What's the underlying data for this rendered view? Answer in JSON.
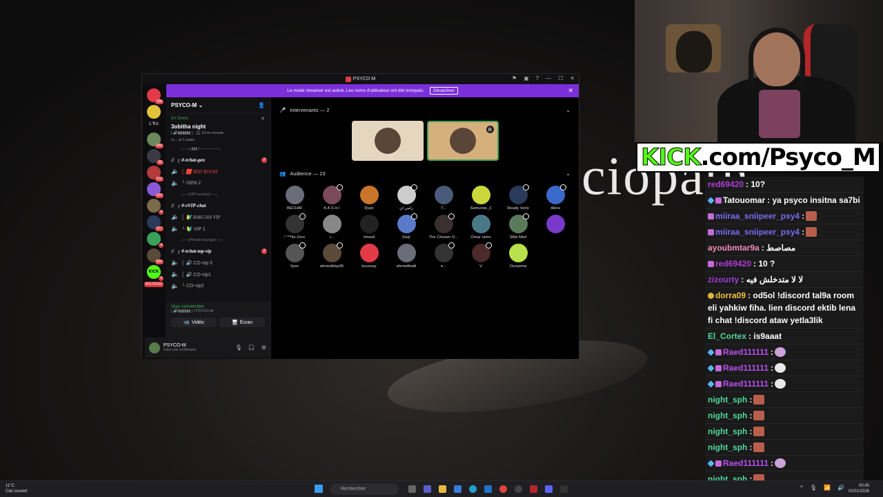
{
  "background": {
    "overlay_text": "ciopath"
  },
  "banner_kick": {
    "brand": "KICK",
    "rest": ".com/Psyco_M"
  },
  "chat": [
    {
      "user": "red69420",
      "color": "#b03bd6",
      "badges": [],
      "text": ": 10?",
      "emote": ""
    },
    {
      "user": "Tatouomar",
      "color": "#ffffff",
      "badges": [
        "b1",
        "b2"
      ],
      "text": ": ya psyco insitna sa7bi",
      "emote": ""
    },
    {
      "user": "miiraa_sniipeer_psy4",
      "color": "#7a6bf0",
      "badges": [
        "b2"
      ],
      "text": ":",
      "emote": "e"
    },
    {
      "user": "miiraa_sniipeer_psy4",
      "color": "#7a6bf0",
      "badges": [
        "b2"
      ],
      "text": ":",
      "emote": "e"
    },
    {
      "user": "ayoubmtar9a",
      "color": "#f28bb5",
      "badges": [],
      "text": ": مصاصط",
      "emote": ""
    },
    {
      "user": "red69420",
      "color": "#b03bd6",
      "badges": [
        "b2"
      ],
      "text": ": 10 ?",
      "emote": ""
    },
    {
      "user": "zizourty",
      "color": "#a03bd6",
      "badges": [],
      "text": ": لا لا متدخلش فيه",
      "emote": ""
    },
    {
      "user": "dorra09",
      "color": "#f0c23a",
      "badges": [
        "b3"
      ],
      "text": ": od5ol !discord tal9a room eli yahkiw fiha. lien discord ektib lena fi chat !discord ataw yetla3lik",
      "emote": ""
    },
    {
      "user": "El_Cortex",
      "color": "#4fd69c",
      "badges": [],
      "text": ": is9aaat",
      "emote": ""
    },
    {
      "user": "Raed111111",
      "color": "#b84ef0",
      "badges": [
        "b1",
        "b2"
      ],
      "text": ":",
      "emote": "g"
    },
    {
      "user": "Raed111111",
      "color": "#b84ef0",
      "badges": [
        "b1",
        "b2"
      ],
      "text": ":",
      "emote": "w"
    },
    {
      "user": "Raed111111",
      "color": "#b84ef0",
      "badges": [
        "b1",
        "b2"
      ],
      "text": ":",
      "emote": "w"
    },
    {
      "user": "night_sph",
      "color": "#4fd69c",
      "badges": [],
      "text": ":",
      "emote": "e"
    },
    {
      "user": "night_sph",
      "color": "#4fd69c",
      "badges": [],
      "text": ":",
      "emote": "e"
    },
    {
      "user": "night_sph",
      "color": "#4fd69c",
      "badges": [],
      "text": ":",
      "emote": "e"
    },
    {
      "user": "night_sph",
      "color": "#4fd69c",
      "badges": [],
      "text": ":",
      "emote": "e"
    },
    {
      "user": "Raed111111",
      "color": "#b84ef0",
      "badges": [
        "b1",
        "b2"
      ],
      "text": ":",
      "emote": "g"
    },
    {
      "user": "night_sph",
      "color": "#4fd69c",
      "badges": [],
      "text": ":",
      "emote": "e"
    }
  ],
  "discord": {
    "title": "PSYCO-M",
    "banner_text": "Le mode streamer est activé. Les noms d'utilisateur ont été tronqués.",
    "banner_button": "Désactiver",
    "guilds": [
      {
        "label": "",
        "count": "33k",
        "color": "#e23b47"
      },
      {
        "label": "",
        "count": "",
        "color": "#e2c23a"
      },
      {
        "label": "L'Ks",
        "count": "",
        "color": ""
      },
      {
        "label": "",
        "count": "346",
        "color": "#6a8a5a"
      },
      {
        "label": "",
        "count": "35",
        "color": "#3a3a44"
      },
      {
        "label": "",
        "count": "611",
        "color": "#b23a3a"
      },
      {
        "label": "",
        "count": "109",
        "color": "#8a5ad6"
      },
      {
        "label": "",
        "count": "4",
        "color": "#7a6a4a"
      },
      {
        "label": "",
        "count": "127",
        "color": "#2a3a5a"
      },
      {
        "label": "",
        "count": "4",
        "color": "#3aa05a"
      },
      {
        "label": "",
        "count": "899",
        "color": "#5a4a3a"
      },
      {
        "label": "KICK",
        "count": "4",
        "color": "#53fc18"
      },
      {
        "label": "NOUVEAU",
        "count": "",
        "color": ""
      }
    ],
    "server_name": "PSYCO-M",
    "live_label": "En Direct",
    "event_name": "3obitha night",
    "event_meta1": "[ 🔊▮▮▮▮▮▮ ] · 🎧 23 en écoute",
    "event_meta2": "m... et 1 autre",
    "channels": [
      {
        "type": "cat",
        "label": "┌──[ ▮▮▮ ]───────┐"
      },
      {
        "type": "text",
        "label": "┌ #-ᴛchat-gen",
        "ping": "1",
        "bold": true
      },
      {
        "type": "voice",
        "label": "│ 🟥 RED ROOM",
        "red": true
      },
      {
        "type": "voice",
        "label": "└ GEN 2"
      },
      {
        "type": "cat",
        "label": "┌──[VIP section]──┐"
      },
      {
        "type": "text",
        "label": "┌ #-ᴠVIP-chat",
        "bold": true
      },
      {
        "type": "voice",
        "label": "│ 🔰 RAKCHA VIP",
        "italic": true
      },
      {
        "type": "voice",
        "label": "└ 🔰 VIP 1"
      },
      {
        "type": "cat",
        "label": "┌──[Private lounge]──┐"
      },
      {
        "type": "text",
        "label": "┌ #-ᴛchat-top-vip",
        "ping": "1",
        "bold": true
      },
      {
        "type": "voice",
        "label": "│ 🔊 CO-vip 3"
      },
      {
        "type": "voice",
        "label": "│ 🔊 CO-vip1"
      },
      {
        "type": "voice",
        "label": "└ CO-vip2"
      }
    ],
    "voice_status": "Voix connectée",
    "voice_sub": "[ 🔊▮▮▮▮▮▮ ] / PSYCO-M",
    "btn_video": "Vidéo",
    "btn_screen": "Écran",
    "user_name": "PSYCO-M",
    "user_status": "Dans une conférence",
    "speakers_label": "Intervenants — 2",
    "audience_label": "Audience — 23",
    "audience": [
      {
        "name": "BECHIR",
        "style": "disc2",
        "mod": false
      },
      {
        "name": "K A S H I",
        "style": "",
        "mod": true
      },
      {
        "name": "Ryan",
        "style": "",
        "mod": false
      },
      {
        "name": "رامي ان",
        "style": "",
        "mod": true
      },
      {
        "name": "T...",
        "style": "",
        "mod": false
      },
      {
        "name": "Samurise_0",
        "style": "",
        "mod": false
      },
      {
        "name": "Ready Vertx",
        "style": "",
        "mod": true
      },
      {
        "name": "Akira",
        "style": "",
        "mod": true
      },
      {
        "name": "! ⁰⁰⁸Its Zero",
        "style": "",
        "mod": true
      },
      {
        "name": "r...",
        "style": "",
        "mod": false
      },
      {
        "name": "Imeed",
        "style": "",
        "mod": false
      },
      {
        "name": "Daly",
        "style": "",
        "mod": true
      },
      {
        "name": "The Chosen O...",
        "style": "",
        "mod": true
      },
      {
        "name": "Omar ramo",
        "style": "",
        "mod": false
      },
      {
        "name": "3Alà Med",
        "style": "",
        "mod": true
      },
      {
        "name": "",
        "style": "",
        "mod": false
      },
      {
        "name": "Ilyes",
        "style": "",
        "mod": true
      },
      {
        "name": "ahmedklay95",
        "style": "",
        "mod": true
      },
      {
        "name": "koussay",
        "style": "red",
        "mod": false
      },
      {
        "name": "ahmedbatti",
        "style": "disc2",
        "mod": false
      },
      {
        "name": "e...",
        "style": "",
        "mod": true
      },
      {
        "name": "V",
        "style": "",
        "mod": true
      },
      {
        "name": "Oussema",
        "style": "",
        "mod": false
      }
    ]
  },
  "taskbar": {
    "weather_temp": "11°C",
    "weather_desc": "Ciel couvert",
    "search_placeholder": "Rechercher",
    "time": "00:45",
    "date": "01/01/2026"
  }
}
